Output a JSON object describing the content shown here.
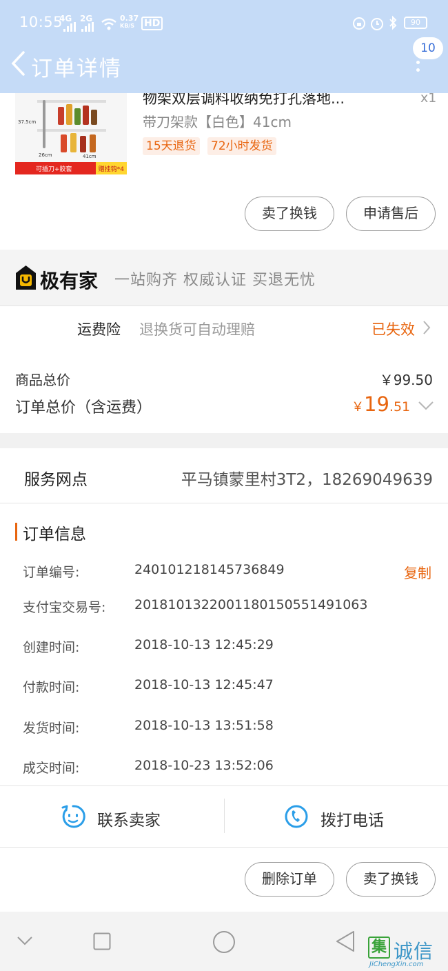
{
  "status_bar": {
    "time": "10:55",
    "signal1": "4G",
    "signal2": "2G",
    "speed": "0.37",
    "speed_unit": "KB/S",
    "hd": "HD",
    "battery": "90"
  },
  "nav": {
    "title": "订单详情",
    "badge_count": "10"
  },
  "product": {
    "name": "物架双层调料收纳免打孔落地...",
    "quantity": "x1",
    "spec": "带刀架款【白色】41cm",
    "tags": [
      "15天退货",
      "72小时发货"
    ],
    "image_text": {
      "height": "37.5cm",
      "depth": "26cm",
      "width": "41cm",
      "strip_left": "可插刀+胶套",
      "strip_right": "赠挂钩*4"
    },
    "actions": [
      "卖了换钱",
      "申请售后"
    ]
  },
  "brand": {
    "name": "极有家",
    "slogan": "一站购齐 权威认证 买退无忧",
    "accent_color": "#f5b800"
  },
  "shipping_insurance": {
    "name": "运费险",
    "description": "退换货可自动理赔",
    "status": "已失效"
  },
  "price": {
    "goods_label": "商品总价",
    "goods_value": "￥99.50",
    "order_label": "订单总价（含运费）",
    "order_currency": "￥",
    "order_integer": "19",
    "order_decimal": ".51",
    "accent_color": "#e8650f"
  },
  "service_point": {
    "label": "服务网点",
    "value": "平马镇蒙里村3T2，18269049639"
  },
  "order_info": {
    "title": "订单信息",
    "copy_label": "复制",
    "rows": [
      {
        "label": "订单编号:",
        "value": "240101218145736849"
      },
      {
        "label": "支付宝交易号:",
        "value": "2018101322001180150551491063"
      },
      {
        "label": "创建时间:",
        "value": "2018-10-13 12:45:29"
      },
      {
        "label": "付款时间:",
        "value": "2018-10-13 12:45:47"
      },
      {
        "label": "发货时间:",
        "value": "2018-10-13 13:51:58"
      },
      {
        "label": "成交时间:",
        "value": "2018-10-23 13:52:06"
      }
    ]
  },
  "contact": {
    "seller_label": "联系卖家",
    "call_label": "拨打电话",
    "icon_color": "#2b9ee8"
  },
  "bottom_actions": [
    "删除订单",
    "卖了换钱"
  ],
  "watermark": {
    "box": "集",
    "text": "诚信",
    "url": "JiChengXin.com"
  }
}
